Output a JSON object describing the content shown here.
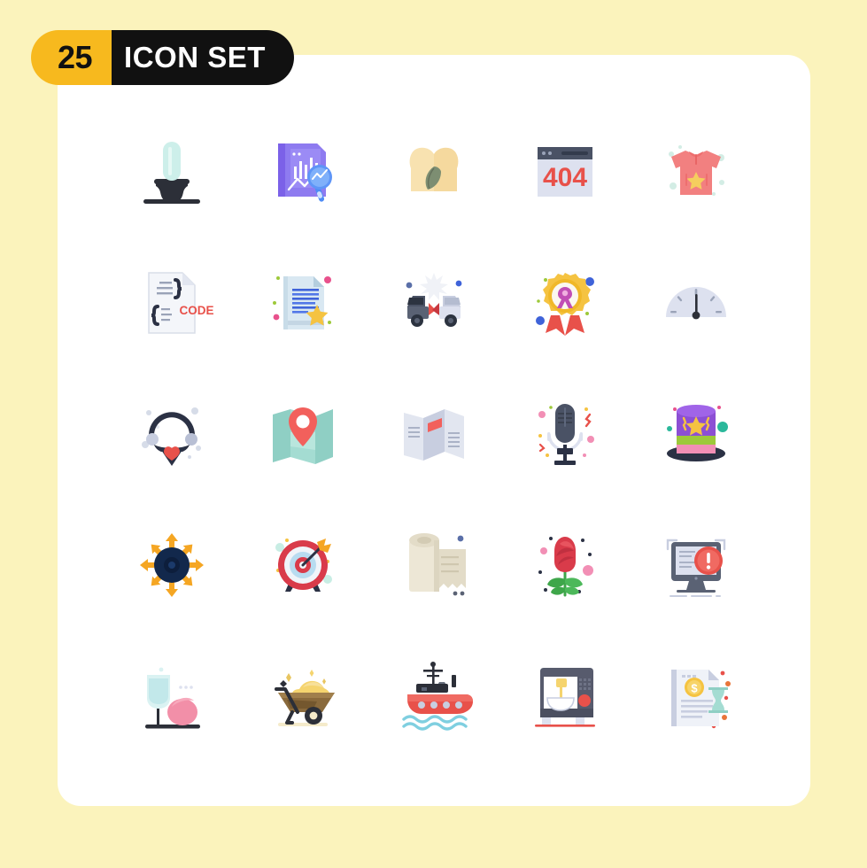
{
  "page": {
    "background_color": "#FBF3BC",
    "card_color": "#FFFFFF"
  },
  "header": {
    "count": "25",
    "title": "ICON SET",
    "count_bg": "#F7B91E",
    "count_fg": "#111111",
    "title_bg": "#111111",
    "title_fg": "#FFFFFF"
  },
  "grid": {
    "columns": 5,
    "rows": 5,
    "total": 25
  },
  "icons": [
    {
      "name": "lamp-icon",
      "label": "Lamp",
      "colors": [
        "#CDEFEA",
        "#2C2F38"
      ]
    },
    {
      "name": "data-analysis-icon",
      "label": "Data Analysis",
      "colors": [
        "#7B61E8",
        "#8E7BF0",
        "#4E8CF5"
      ]
    },
    {
      "name": "mindfulness-icon",
      "label": "Mindfulness",
      "colors": [
        "#F8E2B0",
        "#F6D79B",
        "#7D8E72"
      ]
    },
    {
      "name": "error-404-icon",
      "label": "404 Error",
      "colors": [
        "#4A5265",
        "#DDE1EF",
        "#E8514A"
      ]
    },
    {
      "name": "tshirt-star-icon",
      "label": "T-Shirt",
      "colors": [
        "#F28080",
        "#F5CE5E",
        "#CDEAE2"
      ]
    },
    {
      "name": "code-file-icon",
      "label": "Code File",
      "colors": [
        "#F2F4F8",
        "#2B3144",
        "#E8514A"
      ]
    },
    {
      "name": "favorite-document-icon",
      "label": "Favorite Document",
      "colors": [
        "#C8DCE8",
        "#4A6FE8",
        "#F5C341"
      ]
    },
    {
      "name": "car-crash-icon",
      "label": "Car Crash",
      "colors": [
        "#5A6274",
        "#D6DCE8",
        "#E8514A"
      ]
    },
    {
      "name": "award-ribbon-icon",
      "label": "Award Ribbon",
      "colors": [
        "#F5C341",
        "#C14FB5",
        "#E8514A"
      ]
    },
    {
      "name": "speedometer-icon",
      "label": "Speedometer",
      "colors": [
        "#DDE1EF",
        "#2C2F38"
      ]
    },
    {
      "name": "necklace-icon",
      "label": "Necklace",
      "colors": [
        "#2B3144",
        "#C8CEE0",
        "#E8514A"
      ]
    },
    {
      "name": "map-location-icon",
      "label": "Map Location",
      "colors": [
        "#8FCFC4",
        "#F2605C"
      ]
    },
    {
      "name": "brochure-icon",
      "label": "Brochure",
      "colors": [
        "#E2E6F0",
        "#C8CEE0",
        "#F2605C"
      ]
    },
    {
      "name": "microphone-icon",
      "label": "Microphone",
      "colors": [
        "#4A5265",
        "#D6DCE8",
        "#F28FB5"
      ]
    },
    {
      "name": "magic-hat-icon",
      "label": "Magic Hat",
      "colors": [
        "#8C4FD4",
        "#F5C341",
        "#F28FB5",
        "#9DC93A"
      ]
    },
    {
      "name": "expand-arrows-icon",
      "label": "Expand",
      "colors": [
        "#12284C",
        "#F5A623"
      ]
    },
    {
      "name": "target-arrow-icon",
      "label": "Target",
      "colors": [
        "#D93B4A",
        "#B8DCF0",
        "#F5A623"
      ]
    },
    {
      "name": "paper-roll-icon",
      "label": "Paper Roll",
      "colors": [
        "#E3DCC8",
        "#CFC7AF"
      ]
    },
    {
      "name": "rose-flower-icon",
      "label": "Rose",
      "colors": [
        "#D93B4A",
        "#3EA64A",
        "#F28FB5"
      ]
    },
    {
      "name": "monitor-error-icon",
      "label": "Monitor Error",
      "colors": [
        "#5A6274",
        "#E8514A",
        "#DDE1EF"
      ]
    },
    {
      "name": "cocktail-egg-icon",
      "label": "Cocktail & Egg",
      "colors": [
        "#DAF2F2",
        "#F28FA8",
        "#2C2F38"
      ]
    },
    {
      "name": "wheelbarrow-icon",
      "label": "Wheelbarrow",
      "colors": [
        "#8A6A3C",
        "#F5D46E",
        "#2C2F38"
      ]
    },
    {
      "name": "ship-icon",
      "label": "Ship",
      "colors": [
        "#E8514A",
        "#2C2F38",
        "#7FCFE0"
      ]
    },
    {
      "name": "stand-mixer-icon",
      "label": "Stand Mixer",
      "colors": [
        "#575B6D",
        "#F5D46E",
        "#E8514A"
      ]
    },
    {
      "name": "invoice-money-icon",
      "label": "Invoice",
      "colors": [
        "#DDE1EF",
        "#F5C341",
        "#8FCFC4"
      ]
    }
  ],
  "labels": {
    "code_text": "CODE",
    "error_text": "404",
    "money_symbol": "$"
  }
}
